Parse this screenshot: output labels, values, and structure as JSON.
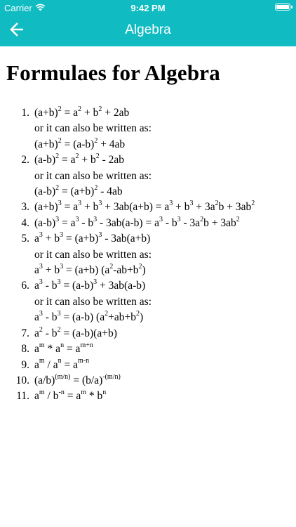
{
  "status_bar": {
    "carrier": "Carrier",
    "time": "9:42 PM"
  },
  "nav": {
    "title": "Algebra"
  },
  "page": {
    "heading": "Formulaes for Algebra"
  },
  "formulas": [
    {
      "number": "1.",
      "lines": [
        [
          [
            "t",
            "(a+b)"
          ],
          [
            "s",
            "2"
          ],
          [
            "t",
            " = a"
          ],
          [
            "s",
            "2"
          ],
          [
            "t",
            " + b"
          ],
          [
            "s",
            "2"
          ],
          [
            "t",
            " + 2ab"
          ]
        ],
        [
          [
            "t",
            "or it can also be written as:"
          ]
        ],
        [
          [
            "t",
            "(a+b)"
          ],
          [
            "s",
            "2"
          ],
          [
            "t",
            " = (a-b)"
          ],
          [
            "s",
            "2"
          ],
          [
            "t",
            " + 4ab"
          ]
        ]
      ]
    },
    {
      "number": "2.",
      "lines": [
        [
          [
            "t",
            "(a-b)"
          ],
          [
            "s",
            "2"
          ],
          [
            "t",
            " = a"
          ],
          [
            "s",
            "2"
          ],
          [
            "t",
            " + b"
          ],
          [
            "s",
            "2"
          ],
          [
            "t",
            " - 2ab"
          ]
        ],
        [
          [
            "t",
            "or it can also be written as:"
          ]
        ],
        [
          [
            "t",
            "(a-b)"
          ],
          [
            "s",
            "2"
          ],
          [
            "t",
            " = (a+b)"
          ],
          [
            "s",
            "2"
          ],
          [
            "t",
            " - 4ab"
          ]
        ]
      ]
    },
    {
      "number": "3.",
      "lines": [
        [
          [
            "t",
            "(a+b)"
          ],
          [
            "s",
            "3"
          ],
          [
            "t",
            " = a"
          ],
          [
            "s",
            "3"
          ],
          [
            "t",
            " + b"
          ],
          [
            "s",
            "3"
          ],
          [
            "t",
            " + 3ab(a+b) = a"
          ],
          [
            "s",
            "3"
          ],
          [
            "t",
            " + b"
          ],
          [
            "s",
            "3"
          ],
          [
            "t",
            " + 3a"
          ],
          [
            "s",
            "2"
          ],
          [
            "t",
            "b + 3ab"
          ],
          [
            "s",
            "2"
          ]
        ]
      ]
    },
    {
      "number": "4.",
      "lines": [
        [
          [
            "t",
            "(a-b)"
          ],
          [
            "s",
            "3"
          ],
          [
            "t",
            " = a"
          ],
          [
            "s",
            "3"
          ],
          [
            "t",
            " - b"
          ],
          [
            "s",
            "3"
          ],
          [
            "t",
            " - 3ab(a-b) = a"
          ],
          [
            "s",
            "3"
          ],
          [
            "t",
            " - b"
          ],
          [
            "s",
            "3"
          ],
          [
            "t",
            " - 3a"
          ],
          [
            "s",
            "2"
          ],
          [
            "t",
            "b + 3ab"
          ],
          [
            "s",
            "2"
          ]
        ]
      ]
    },
    {
      "number": "5.",
      "lines": [
        [
          [
            "t",
            "a"
          ],
          [
            "s",
            "3"
          ],
          [
            "t",
            " + b"
          ],
          [
            "s",
            "3"
          ],
          [
            "t",
            " = (a+b)"
          ],
          [
            "s",
            "3"
          ],
          [
            "t",
            " - 3ab(a+b)"
          ]
        ],
        [
          [
            "t",
            "or it can also be written as:"
          ]
        ],
        [
          [
            "t",
            "a"
          ],
          [
            "s",
            "3"
          ],
          [
            "t",
            " + b"
          ],
          [
            "s",
            "3"
          ],
          [
            "t",
            " = (a+b) (a"
          ],
          [
            "s",
            "2"
          ],
          [
            "t",
            "-ab+b"
          ],
          [
            "s",
            "2"
          ],
          [
            "t",
            ")"
          ]
        ]
      ]
    },
    {
      "number": "6.",
      "lines": [
        [
          [
            "t",
            "a"
          ],
          [
            "s",
            "3"
          ],
          [
            "t",
            " - b"
          ],
          [
            "s",
            "3"
          ],
          [
            "t",
            " = (a-b)"
          ],
          [
            "s",
            "3"
          ],
          [
            "t",
            " + 3ab(a-b)"
          ]
        ],
        [
          [
            "t",
            "or it can also be written as:"
          ]
        ],
        [
          [
            "t",
            "a"
          ],
          [
            "s",
            "3"
          ],
          [
            "t",
            " - b"
          ],
          [
            "s",
            "3"
          ],
          [
            "t",
            " = (a-b) (a"
          ],
          [
            "s",
            "2"
          ],
          [
            "t",
            "+ab+b"
          ],
          [
            "s",
            "2"
          ],
          [
            "t",
            ")"
          ]
        ]
      ]
    },
    {
      "number": "7.",
      "lines": [
        [
          [
            "t",
            "a"
          ],
          [
            "s",
            "2"
          ],
          [
            "t",
            " - b"
          ],
          [
            "s",
            "2"
          ],
          [
            "t",
            " = (a-b)(a+b)"
          ]
        ]
      ]
    },
    {
      "number": "8.",
      "lines": [
        [
          [
            "t",
            "a"
          ],
          [
            "s",
            "m"
          ],
          [
            "t",
            " * a"
          ],
          [
            "s",
            "n"
          ],
          [
            "t",
            " = a"
          ],
          [
            "s",
            "m+n"
          ]
        ]
      ]
    },
    {
      "number": "9.",
      "lines": [
        [
          [
            "t",
            "a"
          ],
          [
            "s",
            "m"
          ],
          [
            "t",
            " / a"
          ],
          [
            "s",
            "n"
          ],
          [
            "t",
            " = a"
          ],
          [
            "s",
            "m-n"
          ]
        ]
      ]
    },
    {
      "number": "10.",
      "lines": [
        [
          [
            "t",
            "(a/b)"
          ],
          [
            "s",
            "(m/n)"
          ],
          [
            "t",
            " = (b/a)"
          ],
          [
            "s",
            "-(m/n)"
          ]
        ]
      ]
    },
    {
      "number": "11.",
      "lines": [
        [
          [
            "t",
            "a"
          ],
          [
            "s",
            "m"
          ],
          [
            "t",
            " / b"
          ],
          [
            "s",
            "-n"
          ],
          [
            "t",
            " = a"
          ],
          [
            "s",
            "m"
          ],
          [
            "t",
            " * b"
          ],
          [
            "s",
            "n"
          ]
        ]
      ]
    }
  ],
  "colors": {
    "header_bg": "#10bcc2",
    "header_text": "#ffffff"
  },
  "icons": {
    "back": "arrow-left-icon",
    "wifi": "wifi-icon",
    "battery": "battery-icon"
  }
}
